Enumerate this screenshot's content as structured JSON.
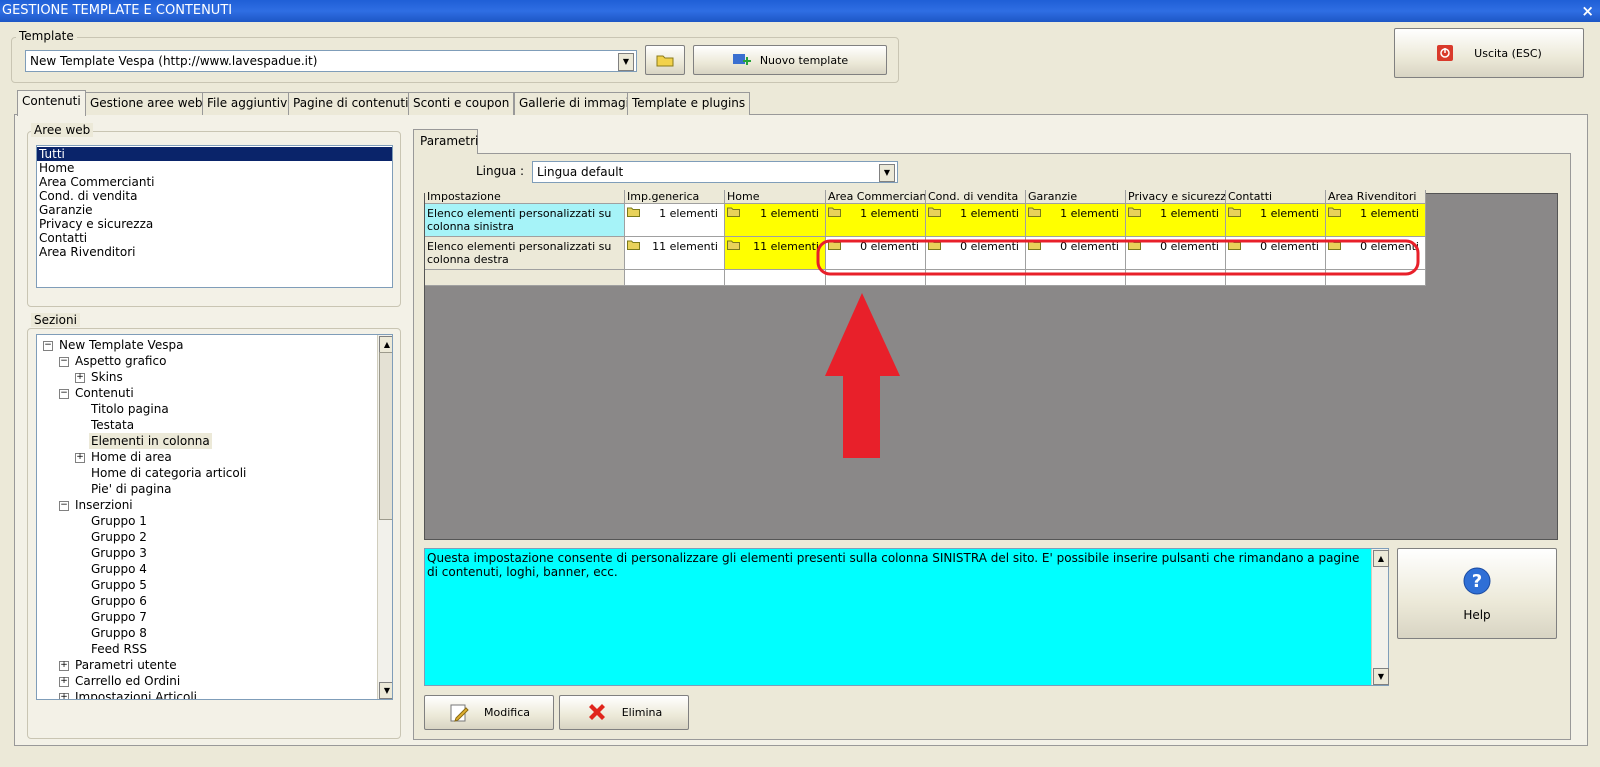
{
  "window": {
    "title": "GESTIONE TEMPLATE E CONTENUTI",
    "close": "×"
  },
  "template": {
    "legend": "Template",
    "selected": "New Template Vespa (http://www.lavespadue.it)",
    "new_button": "Nuovo template"
  },
  "exit_button": "Uscita (ESC)",
  "tabs": [
    "Contenuti",
    "Gestione aree web",
    "File aggiuntivi",
    "Pagine di contenuti",
    "Sconti e coupon",
    "Gallerie di immagini",
    "Template e plugins"
  ],
  "aree_web": {
    "legend": "Aree web",
    "items": [
      "Tutti",
      "Home",
      "Area Commercianti",
      "Cond. di vendita",
      "Garanzie",
      "Privacy e sicurezza",
      "Contatti",
      "Area Rivenditori"
    ]
  },
  "sezioni": {
    "legend": "Sezioni",
    "tree": [
      {
        "label": "New Template Vespa",
        "toggle": "−"
      },
      {
        "label": "Aspetto grafico",
        "toggle": "−"
      },
      {
        "label": "Skins",
        "toggle": "+"
      },
      {
        "label": "Contenuti",
        "toggle": "−"
      },
      {
        "label": "Titolo pagina",
        "toggle": ""
      },
      {
        "label": "Testata",
        "toggle": ""
      },
      {
        "label": "Elementi in colonna",
        "toggle": ""
      },
      {
        "label": "Home di area",
        "toggle": "+"
      },
      {
        "label": "Home di categoria articoli",
        "toggle": ""
      },
      {
        "label": "Pie' di pagina",
        "toggle": ""
      },
      {
        "label": "Inserzioni",
        "toggle": "−"
      },
      {
        "label": "Gruppo 1",
        "toggle": ""
      },
      {
        "label": "Gruppo 2",
        "toggle": ""
      },
      {
        "label": "Gruppo 3",
        "toggle": ""
      },
      {
        "label": "Gruppo 4",
        "toggle": ""
      },
      {
        "label": "Gruppo 5",
        "toggle": ""
      },
      {
        "label": "Gruppo 6",
        "toggle": ""
      },
      {
        "label": "Gruppo 7",
        "toggle": ""
      },
      {
        "label": "Gruppo 8",
        "toggle": ""
      },
      {
        "label": "Feed RSS",
        "toggle": ""
      },
      {
        "label": "Parametri utente",
        "toggle": "+"
      },
      {
        "label": "Carrello ed Ordini",
        "toggle": "+"
      },
      {
        "label": "Impostazioni Articoli",
        "toggle": "+"
      }
    ]
  },
  "parametri": {
    "tab": "Parametri",
    "lingua_label": "Lingua :",
    "lingua_value": "Lingua default"
  },
  "grid": {
    "headers": [
      "Impostazione",
      "Imp.generica",
      "Home",
      "Area Commercianti",
      "Cond. di vendita",
      "Garanzie",
      "Privacy e sicurezza",
      "Contatti",
      "Area Rivenditori"
    ],
    "rows": [
      {
        "label": "Elenco elementi personalizzati su colonna sinistra",
        "values": [
          "1 elementi",
          "1 elementi",
          "1 elementi",
          "1 elementi",
          "1 elementi",
          "1 elementi",
          "1 elementi",
          "1 elementi"
        ]
      },
      {
        "label": "Elenco elementi personalizzati su colonna destra",
        "values": [
          "11 elementi",
          "11 elementi",
          "0 elementi",
          "0 elementi",
          "0 elementi",
          "0 elementi",
          "0 elementi",
          "0 elementi"
        ]
      }
    ]
  },
  "description": "Questa impostazione consente di personalizzare gli elementi presenti sulla colonna SINISTRA del sito. E' possibile inserire pulsanti che rimandano a pagine di contenuti, loghi, banner, ecc.",
  "buttons": {
    "modifica": "Modifica",
    "elimina": "Elimina",
    "help": "Help"
  },
  "colors": {
    "yellow": "#ffff00",
    "cyan": "#00ffff",
    "light_cyan": "#a6f3f8",
    "grid_bg": "#8a8888",
    "annotation_red": "#e8202a"
  },
  "icons": [
    "folder-icon",
    "add-icon",
    "exit-icon",
    "help-icon",
    "edit-icon",
    "delete-icon"
  ]
}
